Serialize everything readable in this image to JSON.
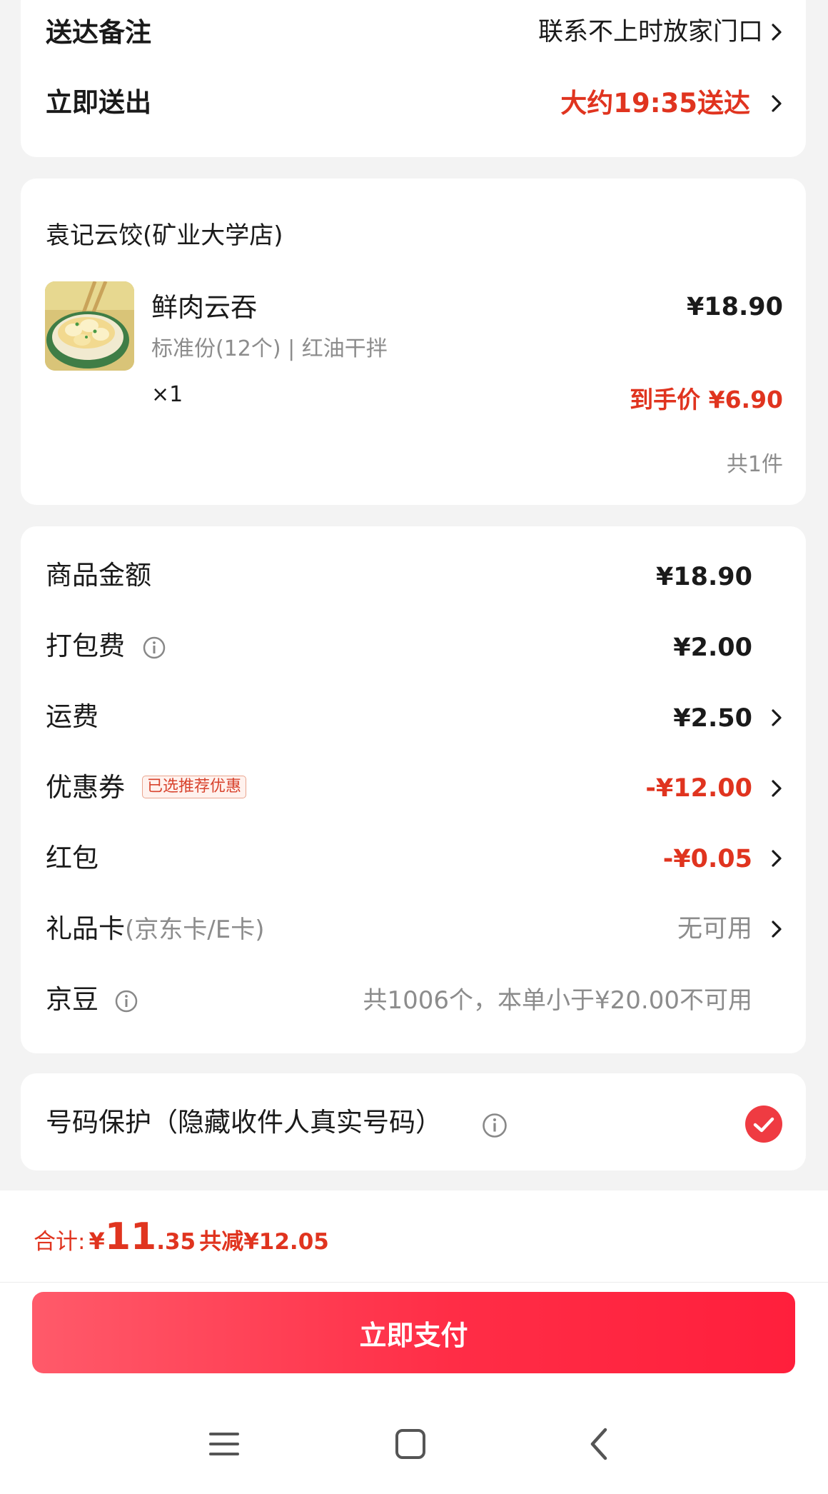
{
  "delivery": {
    "note_label": "送达备注",
    "note_value": "联系不上时放家门口",
    "time_label": "立即送出",
    "time_value": "大约19:35送达"
  },
  "order": {
    "store_name": "袁记云饺(矿业大学店)",
    "item": {
      "name": "鲜肉云吞",
      "spec": "标准份(12个) | 红油干拌",
      "quantity": "×1",
      "price": "¥18.90",
      "final_price": "到手价 ¥6.90"
    },
    "total_count": "共1件"
  },
  "fees": {
    "goods_amount_label": "商品金额",
    "goods_amount_value": "¥18.90",
    "packing_label": "打包费",
    "packing_value": "¥2.00",
    "shipping_label": "运费",
    "shipping_value": "¥2.50",
    "coupon_label": "优惠券",
    "coupon_tag": "已选推荐优惠",
    "coupon_value": "-¥12.00",
    "redpacket_label": "红包",
    "redpacket_value": "-¥0.05",
    "giftcard_label": "礼品卡",
    "giftcard_sub": "(京东卡/E卡)",
    "giftcard_value": "无可用",
    "jingdou_label": "京豆",
    "jingdou_value": "共1006个，本单小于¥20.00不可用"
  },
  "privacy": {
    "label": "号码保护（隐藏收件人真实号码）",
    "checked": true
  },
  "summary": {
    "total_label": "合计:",
    "currency": "¥",
    "total_int": "11",
    "total_dec": ".35",
    "saved": "共减¥12.05"
  },
  "pay_button": "立即支付",
  "colors": {
    "accent_red": "#e0341f",
    "button_gradient_start": "#ff5a6a",
    "button_gradient_end": "#ff1f3c",
    "background": "#f3f3f3"
  },
  "icons": {
    "info": "info-circle-icon",
    "chevron": "chevron-right-icon",
    "check": "check-circle-icon",
    "nav_menu": "menu-icon",
    "nav_home": "home-square-icon",
    "nav_back": "back-chevron-icon"
  }
}
